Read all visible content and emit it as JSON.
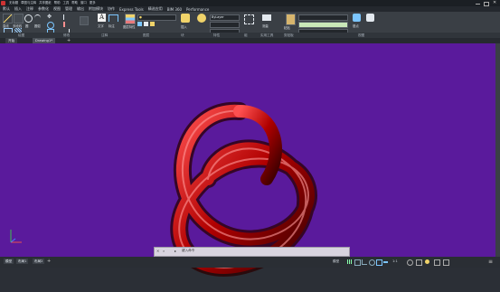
{
  "title_bar": {
    "quick_access": [
      "无标题",
      "草图与注释",
      "共享图纸",
      "帮助",
      "工具",
      "帮助",
      "窗口",
      "更多"
    ]
  },
  "ribbon_tabs": [
    "默认",
    "插入",
    "注释",
    "参数化",
    "视图",
    "管理",
    "输出",
    "附加模块",
    "协作",
    "Express Tools",
    "精选应用",
    "BIM 360",
    "Performance"
  ],
  "panels": [
    "绘图",
    "修改",
    "注释",
    "图层",
    "块",
    "特性",
    "组",
    "实用工具",
    "剪贴板",
    "视图"
  ],
  "ribbon": {
    "line_button": "直线",
    "polyline_button": "多段线",
    "circle_button": "圆",
    "arc_button": "圆弧",
    "text_button": "文字",
    "dimension_button": "标注",
    "layer_properties_button": "图层特性",
    "insert_button": "插入",
    "properties_combo": "ByLayer",
    "measure_button": "测量",
    "paste_button": "粘贴",
    "base_button": "基点"
  },
  "document_tabs": [
    "开始",
    "Drawing1*"
  ],
  "command_line": {
    "prompt": "键入命令"
  },
  "layout_tabs": [
    "模型",
    "布局1",
    "布局2"
  ],
  "status": {
    "model_label": "模型",
    "scale": "1:1"
  },
  "colors": {
    "viewport_bg": "#5a1a9c",
    "knot_color": "#c40000"
  }
}
